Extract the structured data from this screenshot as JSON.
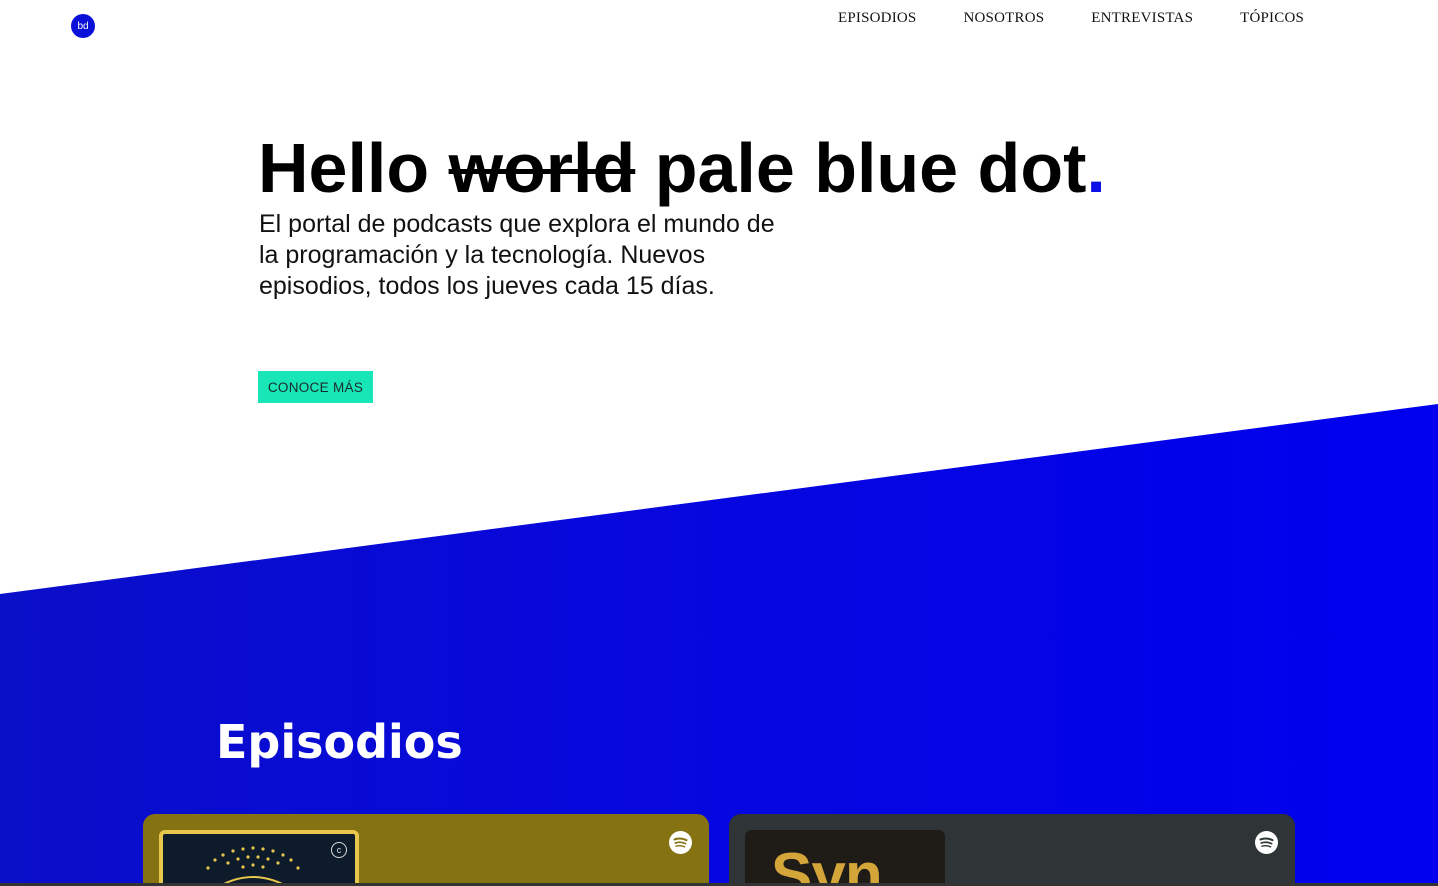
{
  "brand": {
    "logo_text": "bd"
  },
  "nav": {
    "items": [
      "EPISODIOS",
      "NOSOTROS",
      "ENTREVISTAS",
      "TÓPICOS"
    ]
  },
  "hero": {
    "title_start": "Hello ",
    "title_struck": "world",
    "title_rest": " pale blue dot",
    "title_dot": ".",
    "subtitle": "El portal de podcasts que explora el mundo de la programación y la tecnología. Nuevos episodios, todos los jueves cada 15 días.",
    "cta_label": "CONOCE MÁS"
  },
  "episodes": {
    "title": "Episodios",
    "cards": [
      {
        "cover_mark": "c",
        "service_icon": "spotify-icon",
        "color": "#857212"
      },
      {
        "cover_text": "Syn",
        "service_icon": "spotify-icon",
        "color": "#2f3536"
      }
    ]
  },
  "colors": {
    "accent_blue": "#0a10e6",
    "cta_green": "#19e6b6"
  }
}
